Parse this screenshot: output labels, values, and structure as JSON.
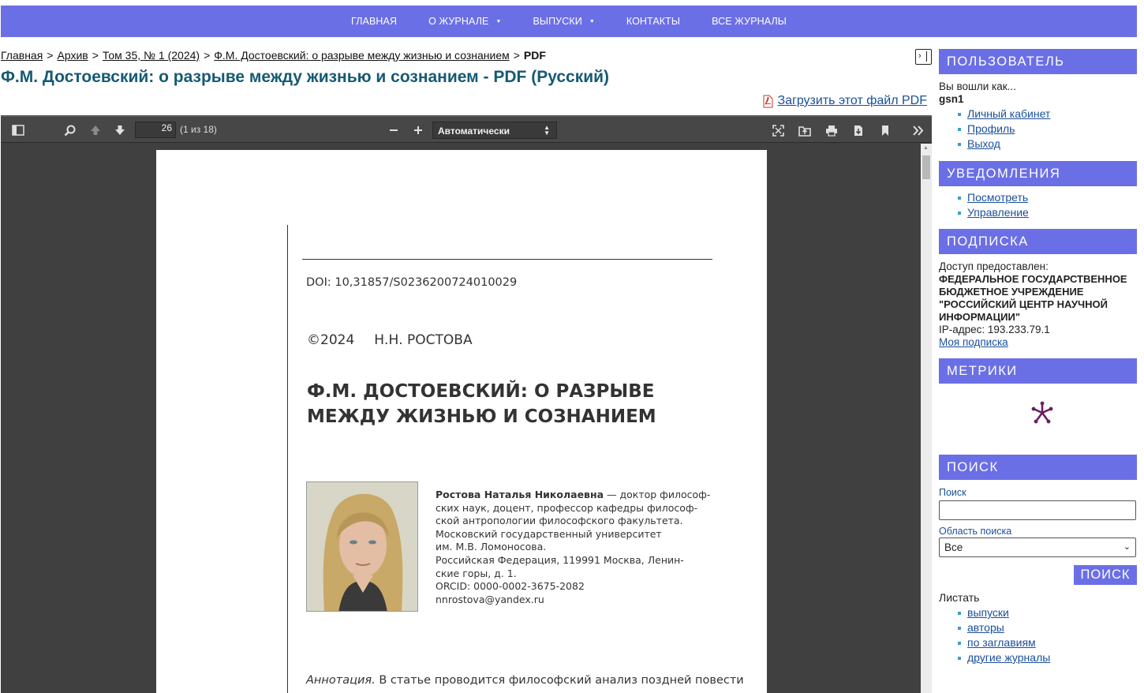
{
  "nav": {
    "items": [
      {
        "label": "ГЛАВНАЯ",
        "dropdown": false
      },
      {
        "label": "О ЖУРНАЛЕ",
        "dropdown": true
      },
      {
        "label": "ВЫПУСКИ",
        "dropdown": true
      },
      {
        "label": "КОНТАКТЫ",
        "dropdown": false
      },
      {
        "label": "ВСЕ ЖУРНАЛЫ",
        "dropdown": false
      }
    ],
    "caret": "▼"
  },
  "breadcrumb": {
    "home": "Главная",
    "archive": "Архив",
    "issue": "Том 35, № 1 (2024)",
    "article": "Ф.М. Достоевский: о разрыве между жизнью и сознанием",
    "current": "PDF",
    "separator": ">"
  },
  "page_title": "Ф.М. Достоевский: о разрыве между жизнью и сознанием - PDF (Русский)",
  "download_label": "Загрузить этот файл PDF",
  "viewer": {
    "page_number": "26",
    "page_count": "(1 из 18)",
    "zoom": "Автоматически"
  },
  "pdf": {
    "doi": "DOI: 10,31857/S0236200724010029",
    "copyright": "©2024",
    "author_short": "Н.Н. РОСТОВА",
    "heading": "Ф.М. ДОСТОЕВСКИЙ: О РАЗРЫВЕ МЕЖДУ ЖИЗНЬЮ И СОЗНАНИЕМ",
    "bio_name": "Ростова Наталья Николаевна",
    "bio_lines": [
      " — доктор философ-",
      "ских наук, доцент, профессор кафедры философ-",
      "ской антропологии философского факультета.",
      "Московский государственный университет",
      "им. М.В. Ломоносова.",
      "Российская Федерация, 119991 Москва, Ленин-",
      "ские горы, д. 1.",
      "ORCID: 0000-0002-3675-2082",
      "nnrostova@yandex.ru"
    ],
    "abstract_label": "Аннотация.",
    "abstract_text": " В статье проводится философский анализ поздней повести"
  },
  "sidebar": {
    "user": {
      "title": "ПОЛЬЗОВАТЕЛЬ",
      "logged_in_as": "Вы вошли как...",
      "username": "gsn1",
      "links": [
        "Личный кабинет",
        "Профиль",
        "Выход"
      ]
    },
    "notifications": {
      "title": "УВЕДОМЛЕНИЯ",
      "links": [
        "Посмотреть",
        "Управление"
      ]
    },
    "subscription": {
      "title": "ПОДПИСКА",
      "access_label": "Доступ предоставлен:",
      "organization": "ФЕДЕРАЛЬНОЕ ГОСУДАРСТВЕННОЕ БЮДЖЕТНОЕ УЧРЕЖДЕНИЕ \"РОССИЙСКИЙ ЦЕНТР НАУЧНОЙ ИНФОРМАЦИИ\"",
      "ip": "IP-адрес: 193.233.79.1",
      "my_subscription": "Моя подписка"
    },
    "metrics": {
      "title": "МЕТРИКИ"
    },
    "search": {
      "title": "ПОИСК",
      "search_label": "Поиск",
      "scope_label": "Область поиска",
      "scope_value": "Все",
      "button": "ПОИСК",
      "browse_label": "Листать",
      "browse_links": [
        "выпуски",
        "авторы",
        "по заглавиям",
        "другие журналы"
      ]
    }
  },
  "colors": {
    "accent": "#6b6fe6",
    "title": "#155a73",
    "link": "#1a4f9b",
    "metrics_icon": "#6b1d5c"
  }
}
